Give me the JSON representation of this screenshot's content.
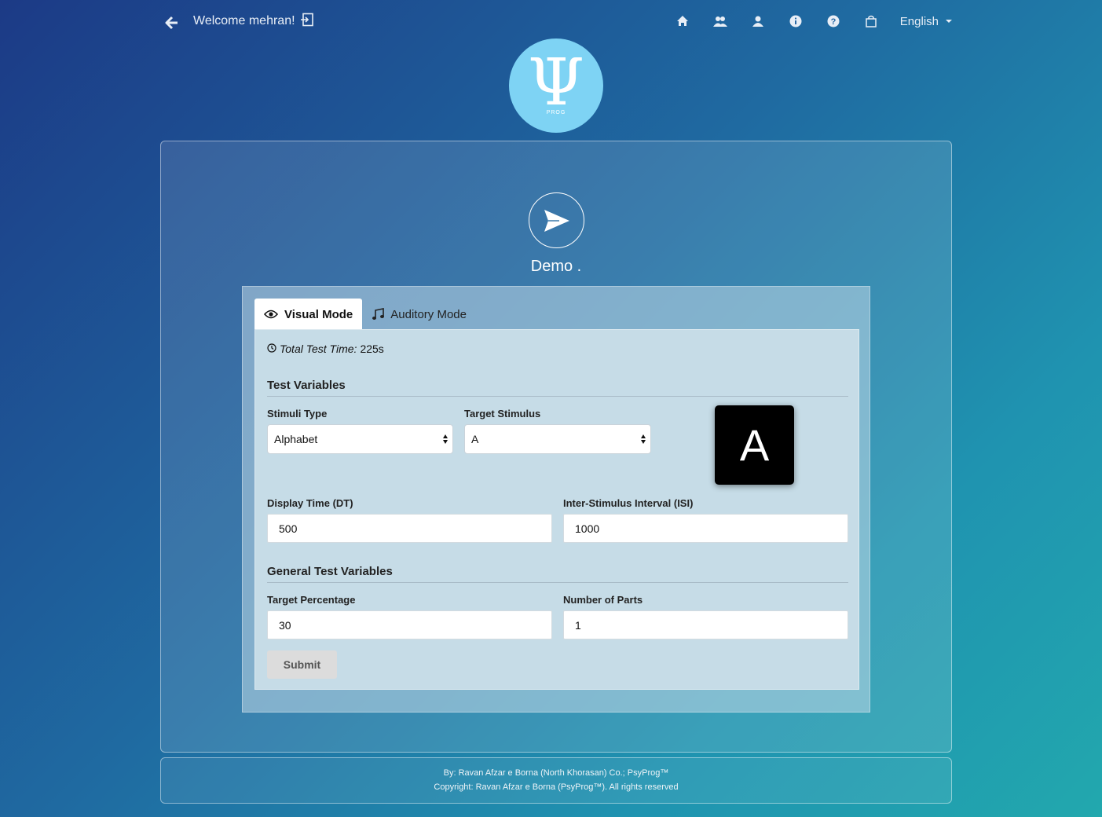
{
  "header": {
    "welcome_text": "Welcome mehran!",
    "language": "English",
    "nav_icons": [
      "home-icon",
      "users-icon",
      "user-icon",
      "info-icon",
      "help-icon",
      "shop-icon"
    ]
  },
  "logo": {
    "symbol": "Ψ",
    "caption": "PROG"
  },
  "page": {
    "title": "Demo ."
  },
  "tabs": [
    {
      "label": "Visual Mode",
      "icon": "eye-icon",
      "active": true
    },
    {
      "label": "Auditory Mode",
      "icon": "music-icon",
      "active": false
    }
  ],
  "form": {
    "total_time_label": "Total Test Time:",
    "total_time_value": "225s",
    "test_variables_heading": "Test Variables",
    "stimuli_type_label": "Stimuli Type",
    "stimuli_type_value": "Alphabet",
    "target_stimulus_label": "Target Stimulus",
    "target_stimulus_value": "A",
    "preview_letter": "A",
    "display_time_label": "Display Time (DT)",
    "display_time_value": "500",
    "isi_label": "Inter-Stimulus Interval (ISI)",
    "isi_value": "1000",
    "general_heading": "General Test Variables",
    "target_percentage_label": "Target Percentage",
    "target_percentage_value": "30",
    "parts_label": "Number of Parts",
    "parts_value": "1",
    "submit_label": "Submit"
  },
  "footer": {
    "line1": "By: Ravan Afzar e Borna (North Khorasan) Co.; PsyProg™",
    "line2": "Copyright: Ravan Afzar e Borna (PsyProg™). All rights reserved"
  },
  "colors": {
    "logo_bg": "#7ed3f4",
    "preview_bg": "#000000",
    "submit_bg": "#dcdcdc"
  }
}
